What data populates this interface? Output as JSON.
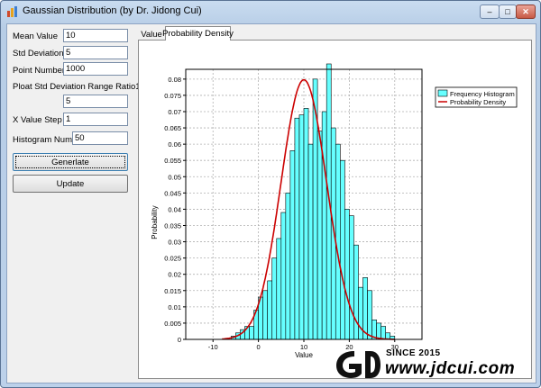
{
  "window": {
    "title": "Gaussian Distribution (by Dr. Jidong Cui)",
    "controls": {
      "minimize": "–",
      "maximize": "□",
      "close": "✕"
    }
  },
  "form": {
    "mean_label": "Mean Value",
    "mean_value": "10",
    "std_label": "Std Deviation",
    "std_value": "5",
    "points_label": "Point Number",
    "points_value": "1000",
    "ratio_label": "Ploat Std Deviation Range Ratio1",
    "ratio_value": "5",
    "xstep_label": "X Value Step",
    "xstep_value": "1",
    "hist_label": "Histogram Number",
    "hist_value": "50",
    "generate_label": "Generlate",
    "update_label": "Update"
  },
  "tabs": [
    {
      "label": "Value",
      "active": false
    },
    {
      "label": "Probability Density",
      "active": true
    }
  ],
  "chart_data": {
    "type": "bar",
    "xlabel": "Value",
    "ylabel": "Probability",
    "xlim": [
      -16,
      36
    ],
    "ylim": [
      0,
      0.083
    ],
    "x_ticks": [
      -10,
      0,
      10,
      20,
      30
    ],
    "y_ticks": [
      0,
      0.005,
      0.01,
      0.015,
      0.02,
      0.025,
      0.03,
      0.035,
      0.04,
      0.045,
      0.05,
      0.055,
      0.06,
      0.065,
      0.07,
      0.075,
      0.08
    ],
    "grid": true,
    "legend_position": "top-right",
    "series": [
      {
        "name": "Frequency Histogram",
        "kind": "histogram",
        "color": "#66ffff",
        "bin_start": -6,
        "bin_width": 1,
        "values": [
          0.001,
          0.002,
          0.003,
          0.004,
          0.004,
          0.009,
          0.013,
          0.015,
          0.018,
          0.025,
          0.031,
          0.039,
          0.045,
          0.058,
          0.068,
          0.069,
          0.071,
          0.06,
          0.08,
          0.064,
          0.07,
          0.084,
          0.065,
          0.06,
          0.055,
          0.04,
          0.038,
          0.029,
          0.016,
          0.019,
          0.015,
          0.006,
          0.005,
          0.004,
          0.002,
          0.001
        ]
      },
      {
        "name": "Probability Density",
        "kind": "line",
        "color": "#cc0000",
        "mean": 10,
        "std": 5
      }
    ]
  },
  "watermark": {
    "logo_text": "GD",
    "since": "SINCE 2015",
    "site": "www.jdcui.com"
  },
  "colors": {
    "bar_fill": "#66ffff",
    "bar_stroke": "#000000",
    "curve": "#cc0000",
    "grid": "#b0b0b0"
  }
}
